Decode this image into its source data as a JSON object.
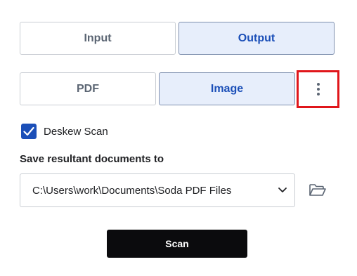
{
  "mode_toggle": {
    "input_label": "Input",
    "output_label": "Output",
    "selected": "Output"
  },
  "format_toggle": {
    "pdf_label": "PDF",
    "image_label": "Image",
    "selected": "Image"
  },
  "more_options": {
    "icon": "vertical-ellipsis-icon",
    "highlight_color": "#e0161b"
  },
  "deskew": {
    "label": "Deskew Scan",
    "checked": true
  },
  "save_location": {
    "label": "Save resultant documents to",
    "path": "C:\\Users\\work\\Documents\\Soda PDF Files",
    "browse_icon": "folder-open-icon"
  },
  "scan_button": {
    "label": "Scan"
  },
  "colors": {
    "accent": "#1b4fb8",
    "active_bg": "#e7eefb",
    "scan_bg": "#0b0b0d"
  }
}
